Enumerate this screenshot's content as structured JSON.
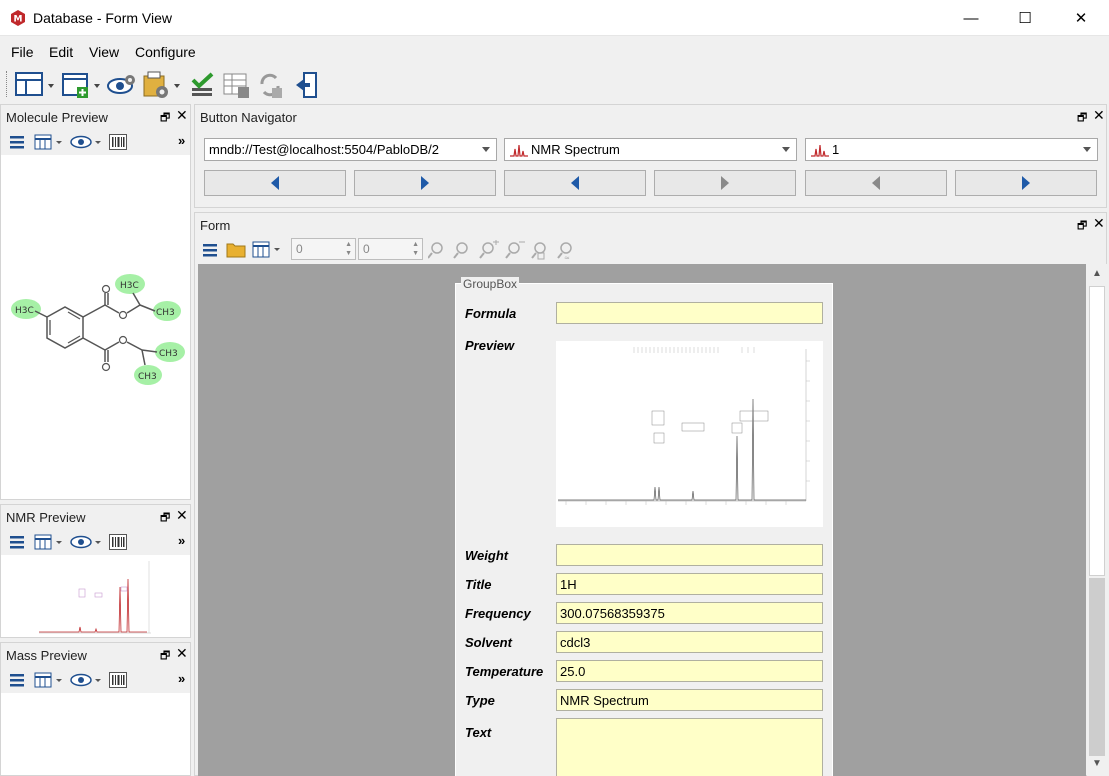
{
  "window": {
    "title": "Database - Form View",
    "minimize": "—",
    "maximize": "☐",
    "close": "✕"
  },
  "menu": [
    "File",
    "Edit",
    "View",
    "Configure"
  ],
  "panels": {
    "molecule_preview": "Molecule Preview",
    "nmr_preview": "NMR Preview",
    "mass_preview": "Mass Preview",
    "button_navigator": "Button Navigator",
    "form": "Form"
  },
  "navigator": {
    "db_path": "mndb://Test@localhost:5504/PabloDB/2",
    "record_type": "NMR Spectrum",
    "record_index": "1"
  },
  "form_toolbar": {
    "spin1": "0",
    "spin2": "0"
  },
  "groupbox": {
    "title": "GroupBox",
    "fields": [
      {
        "label": "Formula",
        "value": ""
      },
      {
        "label": "Preview",
        "value": ""
      },
      {
        "label": "Weight",
        "value": ""
      },
      {
        "label": "Title",
        "value": "1H"
      },
      {
        "label": "Frequency",
        "value": "300.07568359375"
      },
      {
        "label": "Solvent",
        "value": "cdcl3"
      },
      {
        "label": "Temperature",
        "value": "25.0"
      },
      {
        "label": "Type",
        "value": "NMR Spectrum"
      },
      {
        "label": "Text",
        "value": ""
      }
    ]
  },
  "molecule": {
    "labels": [
      "H3C",
      "H3C",
      "CH3",
      "CH3",
      "CH3"
    ]
  },
  "colors": {
    "accent": "#1f5aa8",
    "field_bg": "#ffffc8",
    "atom_highlight": "#a6f0a6",
    "spectrum": "#c0282b"
  }
}
